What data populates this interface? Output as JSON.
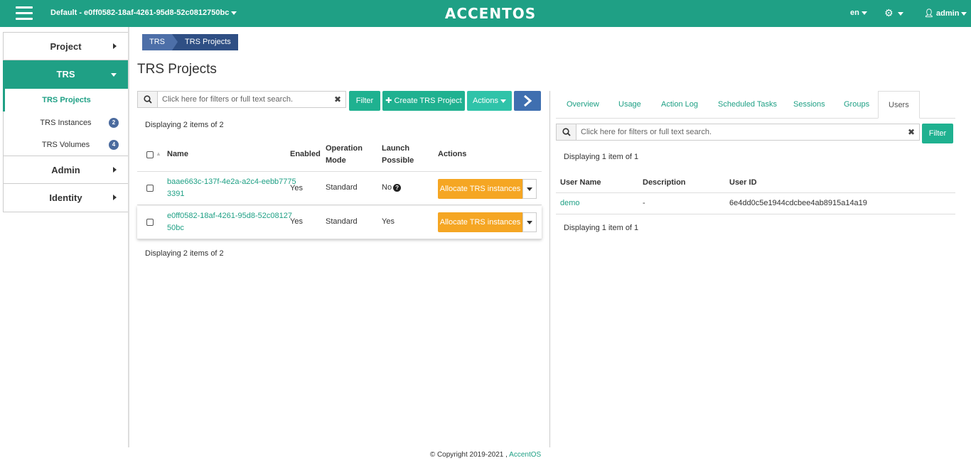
{
  "header": {
    "project": "Default - e0ff0582-18af-4261-95d8-52c0812750bc",
    "brand": "ACCENTOS",
    "lang": "en",
    "user": "admin"
  },
  "sidebar": {
    "items": [
      {
        "label": "Project"
      },
      {
        "label": "TRS"
      },
      {
        "label": "Admin"
      },
      {
        "label": "Identity"
      }
    ],
    "sub": [
      {
        "label": "TRS Projects"
      },
      {
        "label": "TRS Instances",
        "badge": "2"
      },
      {
        "label": "TRS Volumes",
        "badge": "4"
      }
    ]
  },
  "breadcrumb": [
    "TRS",
    "TRS Projects"
  ],
  "page_title": "TRS Projects",
  "left": {
    "search_placeholder": "Click here for filters or full text search.",
    "filter_label": "Filter",
    "create_label": "Create TRS Project",
    "actions_label": "Actions",
    "displaying_top": "Displaying 2 items of 2",
    "displaying_bottom": "Displaying 2 items of 2",
    "columns": {
      "name": "Name",
      "enabled": "Enabled",
      "op_mode_1": "Operation",
      "op_mode_2": "Mode",
      "launch_1": "Launch",
      "launch_2": "Possible",
      "actions": "Actions"
    },
    "rows": [
      {
        "name_1": "baae663c-137f-4e2a-a2c4-eebb7775",
        "name_2": "3391",
        "enabled": "Yes",
        "mode": "Standard",
        "launch": "No",
        "action": "Allocate TRS instances"
      },
      {
        "name_1": "e0ff0582-18af-4261-95d8-52c08127",
        "name_2": "50bc",
        "enabled": "Yes",
        "mode": "Standard",
        "launch": "Yes",
        "action": "Allocate TRS instances"
      }
    ]
  },
  "right": {
    "tabs": [
      "Overview",
      "Usage",
      "Action Log",
      "Scheduled Tasks",
      "Sessions",
      "Groups",
      "Users"
    ],
    "search_placeholder": "Click here for filters or full text search.",
    "filter_label": "Filter",
    "displaying_top": "Displaying 1 item of 1",
    "displaying_bottom": "Displaying 1 item of 1",
    "columns": {
      "user_name": "User Name",
      "description": "Description",
      "user_id": "User ID"
    },
    "rows": [
      {
        "user_name": "demo",
        "description": "-",
        "user_id": "6e4dd0c5e1944cdcbee4ab8915a14a19"
      }
    ]
  },
  "footer": {
    "copyright": "© Copyright 2019-2021 ,",
    "brand_link": "AccentOS"
  }
}
